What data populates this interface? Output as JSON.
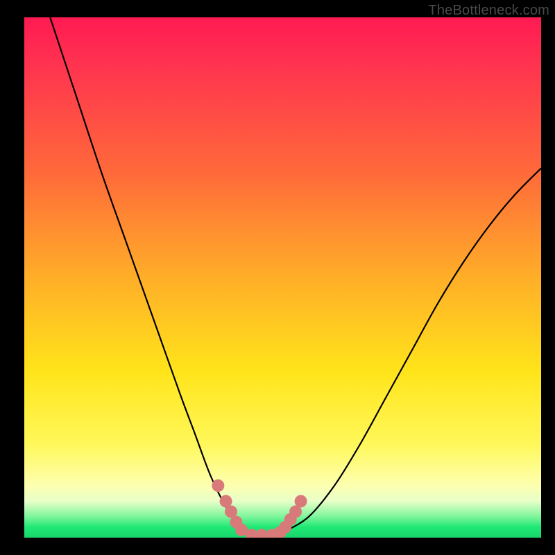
{
  "watermark": "TheBottleneck.com",
  "colors": {
    "background": "#000000",
    "curve_stroke": "#000000",
    "marker_fill": "#d97a7a"
  },
  "chart_data": {
    "type": "line",
    "title": "",
    "xlabel": "",
    "ylabel": "",
    "xlim": [
      0,
      100
    ],
    "ylim": [
      0,
      100
    ],
    "grid": false,
    "series": [
      {
        "name": "bottleneck-curve",
        "x": [
          5,
          10,
          15,
          20,
          25,
          30,
          33,
          36,
          39,
          42,
          44,
          46,
          48,
          50,
          55,
          60,
          65,
          70,
          75,
          80,
          85,
          90,
          95,
          100
        ],
        "y": [
          100,
          85,
          70,
          56,
          42,
          28,
          20,
          12,
          6,
          2,
          0,
          0,
          0,
          1,
          4,
          10,
          18,
          27,
          36,
          45,
          53,
          60,
          66,
          71
        ]
      }
    ],
    "markers": {
      "name": "highlight-points",
      "x": [
        37.5,
        39.0,
        40.0,
        41.0,
        42.0,
        44.0,
        46.0,
        48.0,
        49.5,
        50.5,
        51.5,
        52.5,
        53.5
      ],
      "y": [
        10.0,
        7.0,
        5.0,
        3.0,
        1.5,
        0.5,
        0.5,
        0.5,
        1.0,
        2.0,
        3.5,
        5.0,
        7.0
      ]
    }
  }
}
